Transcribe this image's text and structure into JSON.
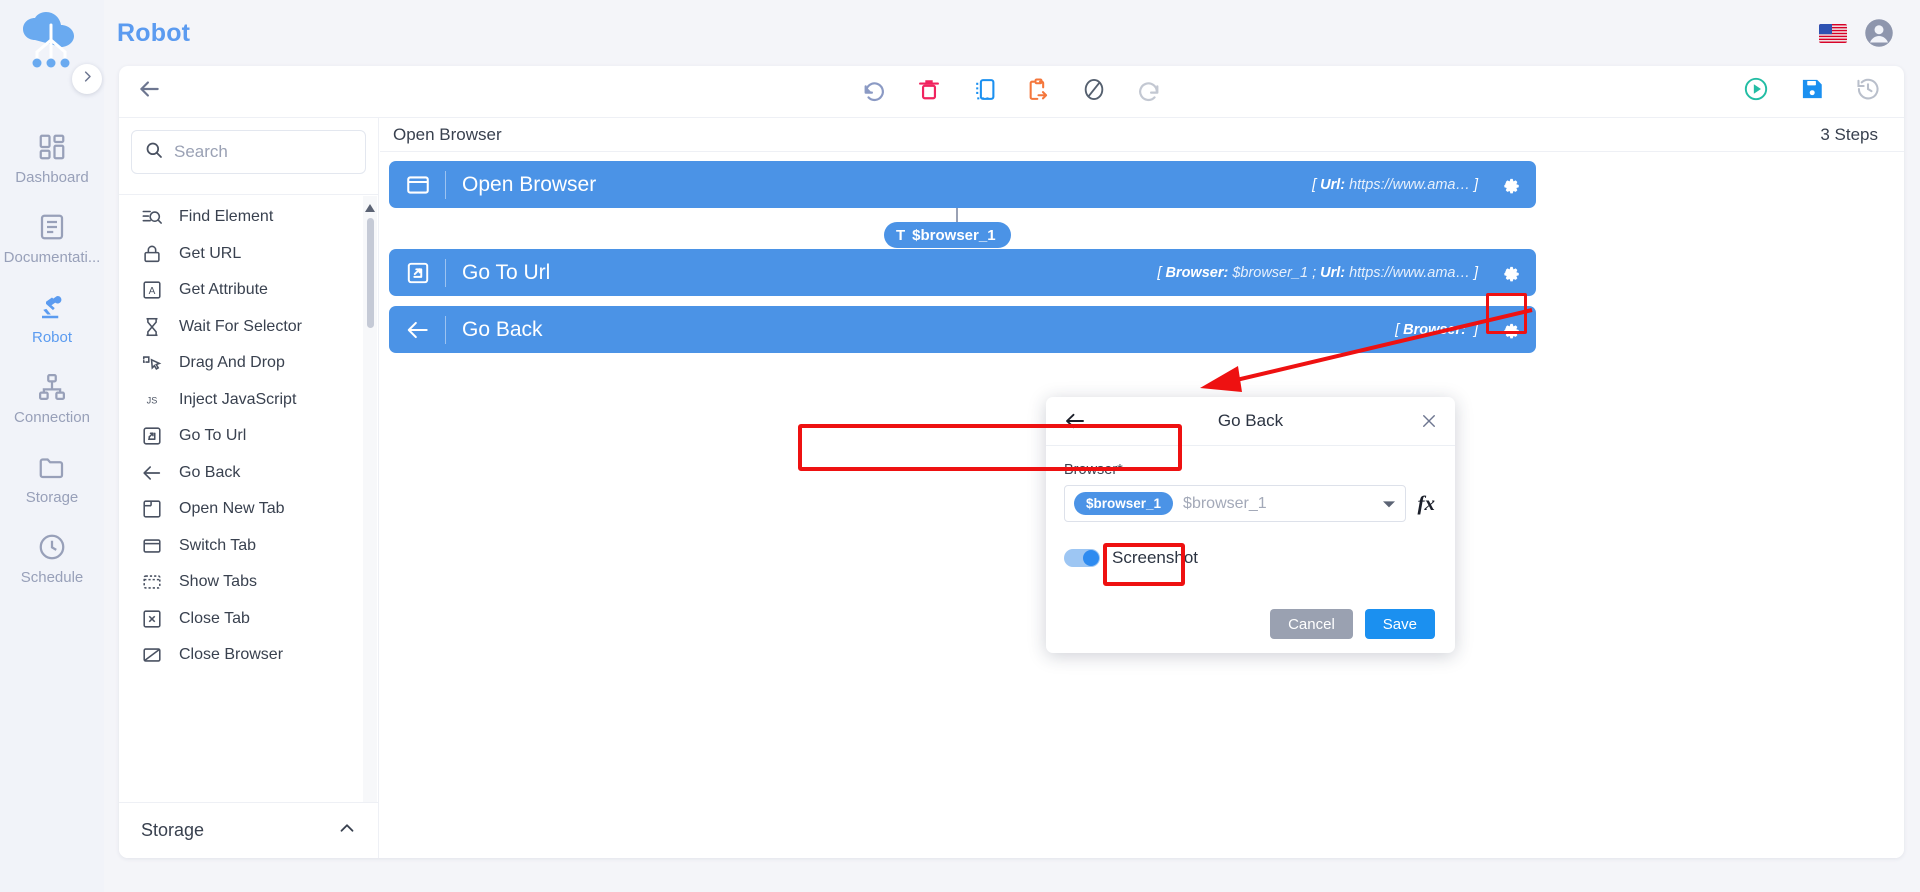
{
  "app": {
    "title": "Robot",
    "logo_icon": "cloud-robot-logo",
    "expand_icon": "chevron-right-icon",
    "flag_icon": "us-flag-icon",
    "account_icon": "account-circle-icon"
  },
  "rail": {
    "items": [
      {
        "label": "Dashboard",
        "icon": "dashboard-icon",
        "active": false
      },
      {
        "label": "Documentati...",
        "icon": "document-icon",
        "active": false
      },
      {
        "label": "Robot",
        "icon": "robot-arm-icon",
        "active": true
      },
      {
        "label": "Connection",
        "icon": "sitemap-icon",
        "active": false
      },
      {
        "label": "Storage",
        "icon": "folder-icon",
        "active": false
      },
      {
        "label": "Schedule",
        "icon": "clock-icon",
        "active": false
      }
    ]
  },
  "toolbar": {
    "back_icon": "arrow-left-icon",
    "center_buttons": [
      {
        "name": "undo-button",
        "icon": "undo-icon",
        "color": "#8b9ac4"
      },
      {
        "name": "delete-button",
        "icon": "trash-icon",
        "color": "#f0245f"
      },
      {
        "name": "copy-button",
        "icon": "copy-icon",
        "color": "#1b90f0"
      },
      {
        "name": "paste-button",
        "icon": "paste-icon",
        "color": "#f4773c"
      },
      {
        "name": "disable-button",
        "icon": "block-circle-icon",
        "color": "#55606f"
      },
      {
        "name": "redo-button",
        "icon": "redo-icon",
        "color": "#c3c8d2"
      }
    ],
    "right_buttons": [
      {
        "name": "run-button",
        "icon": "play-circle-icon",
        "color": "#23bda4"
      },
      {
        "name": "save-button",
        "icon": "floppy-save-icon",
        "color": "#1b90f0"
      },
      {
        "name": "history-button",
        "icon": "history-clock-icon",
        "color": "#b9bfcb"
      }
    ]
  },
  "action_panel": {
    "search": {
      "placeholder": "Search",
      "value": "",
      "icon": "search-icon"
    },
    "actions": [
      {
        "label": "Find Element",
        "icon": "find-element-icon"
      },
      {
        "label": "Get URL",
        "icon": "lock-icon"
      },
      {
        "label": "Get Attribute",
        "icon": "letter-a-box-icon"
      },
      {
        "label": "Wait For Selector",
        "icon": "hourglass-icon"
      },
      {
        "label": "Drag And Drop",
        "icon": "drag-drop-icon"
      },
      {
        "label": "Inject JavaScript",
        "icon": "javascript-icon"
      },
      {
        "label": "Go To Url",
        "icon": "go-to-url-icon"
      },
      {
        "label": "Go Back",
        "icon": "arrow-left-icon"
      },
      {
        "label": "Open New Tab",
        "icon": "new-tab-icon"
      },
      {
        "label": "Switch Tab",
        "icon": "switch-tab-icon"
      },
      {
        "label": "Show Tabs",
        "icon": "show-tabs-icon"
      },
      {
        "label": "Close Tab",
        "icon": "close-tab-icon"
      },
      {
        "label": "Close Browser",
        "icon": "close-browser-icon"
      }
    ],
    "storage_section": {
      "label": "Storage",
      "chevron_icon": "chevron-up-icon"
    }
  },
  "canvas": {
    "flow_title": "Open Browser",
    "step_count": "3 Steps",
    "steps": [
      {
        "label": "Open Browser",
        "icon": "browser-window-icon",
        "params_prefix": "[",
        "params": [
          {
            "key": "Url:",
            "value": "https://www.ama…"
          }
        ],
        "params_suffix": "]",
        "gear_icon": "gear-icon"
      },
      {
        "label": "Go To Url",
        "icon": "go-to-url-icon",
        "params_prefix": "[",
        "params": [
          {
            "key": "Browser:",
            "value": "$browser_1"
          },
          {
            "key": "Url:",
            "value": "https://www.ama…",
            "separator": ";"
          }
        ],
        "params_suffix": "]",
        "gear_icon": "gear-icon"
      },
      {
        "label": "Go Back",
        "icon": "arrow-left-icon",
        "params_prefix": "[",
        "params": [
          {
            "key": "Browser:",
            "value": ""
          }
        ],
        "params_suffix": "]",
        "gear_icon": "gear-icon"
      }
    ],
    "connector_variable": {
      "glyph": "T",
      "label": "$browser_1"
    }
  },
  "modal": {
    "title": "Go Back",
    "back_icon": "arrow-left-icon",
    "close_icon": "close-icon",
    "field_label": "Browser*",
    "browser_token": "$browser_1",
    "browser_placeholder": "$browser_1",
    "caret_icon": "chevron-down-icon",
    "fx_label": "fx",
    "screenshot_label": "Screenshot",
    "screenshot_on": true,
    "cancel_label": "Cancel",
    "save_label": "Save"
  },
  "annotations": {
    "color": "#ee1111",
    "highlights": [
      "step-gear-button",
      "browser-field",
      "save-button"
    ]
  }
}
